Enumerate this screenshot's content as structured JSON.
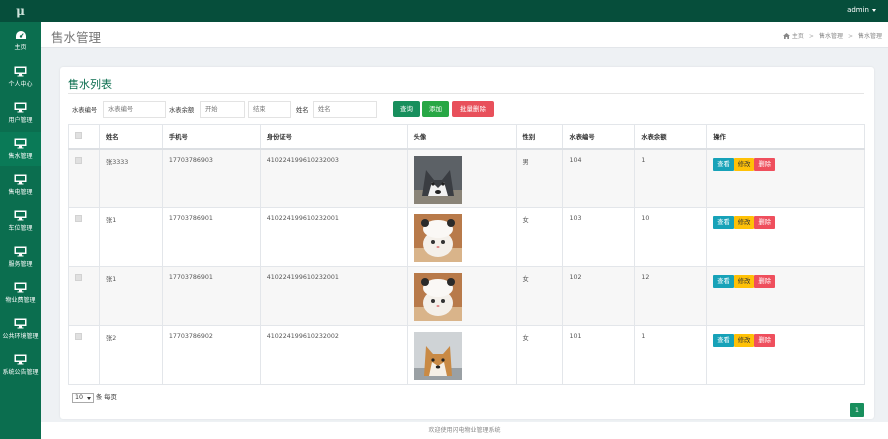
{
  "app": {
    "logo": "μ",
    "user": "admin"
  },
  "sidebar": {
    "items": [
      {
        "label": "主页",
        "icon": "dashboard-icon"
      },
      {
        "label": "个人中心",
        "icon": "monitor-icon"
      },
      {
        "label": "用户管理",
        "icon": "monitor-icon"
      },
      {
        "label": "售水管理",
        "icon": "monitor-icon"
      },
      {
        "label": "售电管理",
        "icon": "monitor-icon"
      },
      {
        "label": "车位管理",
        "icon": "monitor-icon"
      },
      {
        "label": "服务管理",
        "icon": "monitor-icon"
      },
      {
        "label": "物业费管理",
        "icon": "monitor-icon"
      },
      {
        "label": "公共环境管理",
        "icon": "monitor-icon"
      },
      {
        "label": "系统公告管理",
        "icon": "monitor-icon"
      }
    ]
  },
  "header": {
    "title": "售水管理",
    "breadcrumb": [
      "主页",
      "售水管理",
      "售水管理"
    ]
  },
  "card": {
    "title": "售水列表"
  },
  "search": {
    "meter_label": "水表编号",
    "meter_placeholder": "水表编号",
    "balance_label": "水表余额",
    "start_placeholder": "开始",
    "end_placeholder": "结束",
    "name_label": "姓名",
    "name_placeholder": "姓名",
    "query_label": "查询",
    "add_label": "添加",
    "batch_delete_label": "批量删除"
  },
  "table": {
    "columns": [
      "姓名",
      "手机号",
      "身份证号",
      "头像",
      "性别",
      "水表编号",
      "水表余额",
      "操作"
    ],
    "rows": [
      {
        "name": "张3333",
        "phone": "17703786903",
        "id_card": "410224199610232003",
        "avatar": "husky-photo",
        "gender": "男",
        "meter": "104",
        "balance": "1"
      },
      {
        "name": "张1",
        "phone": "17703786901",
        "id_card": "410224199610232001",
        "avatar": "cat-hat-photo",
        "gender": "女",
        "meter": "103",
        "balance": "10"
      },
      {
        "name": "张1",
        "phone": "17703786901",
        "id_card": "410224199610232001",
        "avatar": "cat-hat-photo",
        "gender": "女",
        "meter": "102",
        "balance": "12"
      },
      {
        "name": "张2",
        "phone": "17703786902",
        "id_card": "410224199610232002",
        "avatar": "shiba-photo",
        "gender": "女",
        "meter": "101",
        "balance": "1"
      }
    ],
    "actions": {
      "view": "查看",
      "edit": "修改",
      "delete": "删除"
    }
  },
  "pager": {
    "page_size": "10",
    "per_page_label": "条 每页",
    "current_page": "1"
  },
  "footer": {
    "text": "欢迎使用闪电物业管理系统"
  },
  "colors": {
    "topbar": "#064e3b",
    "sidebar": "#0b6e4f",
    "accent": "#188f5d",
    "add": "#28a745",
    "danger": "#e8505b",
    "info": "#17a2b8",
    "warning": "#ffc107"
  }
}
